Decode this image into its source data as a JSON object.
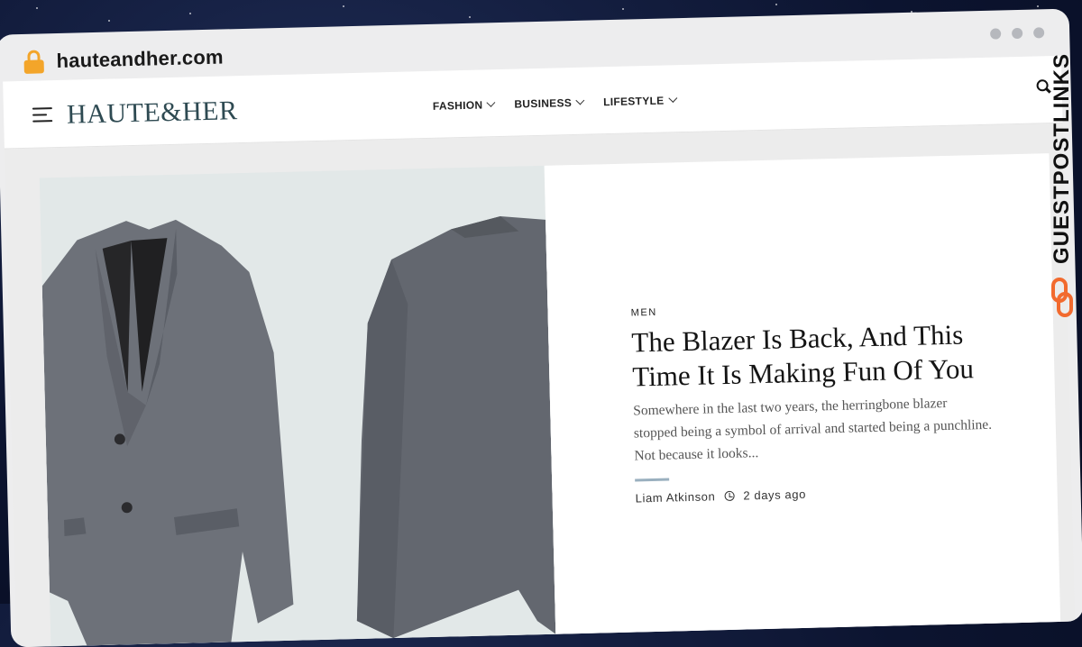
{
  "browser": {
    "url": "hauteandher.com"
  },
  "site": {
    "logo": "HAUTE&HER",
    "nav": [
      {
        "label": "FASHION"
      },
      {
        "label": "BUSINESS"
      },
      {
        "label": "LIFESTYLE"
      }
    ]
  },
  "featured": {
    "category": "MEN",
    "title": "The Blazer Is Back, And This Time It Is Making Fun Of You",
    "excerpt": "Somewhere in the last two years, the herringbone blazer stopped being a symbol of arrival and started being a punchline. Not because it looks...",
    "author": "Liam Atkinson",
    "time": "2 days ago"
  },
  "watermark": {
    "text": "GUESTPOSTLINKS"
  },
  "colors": {
    "accent": "#f3a52a",
    "logo": "#2e4a52",
    "watermark_logo": "#f26a2e",
    "blazer": "#6b7078"
  },
  "icons": [
    "lock-icon",
    "hamburger-icon",
    "chevron-down-icon",
    "search-icon",
    "clock-icon",
    "link-icon"
  ]
}
